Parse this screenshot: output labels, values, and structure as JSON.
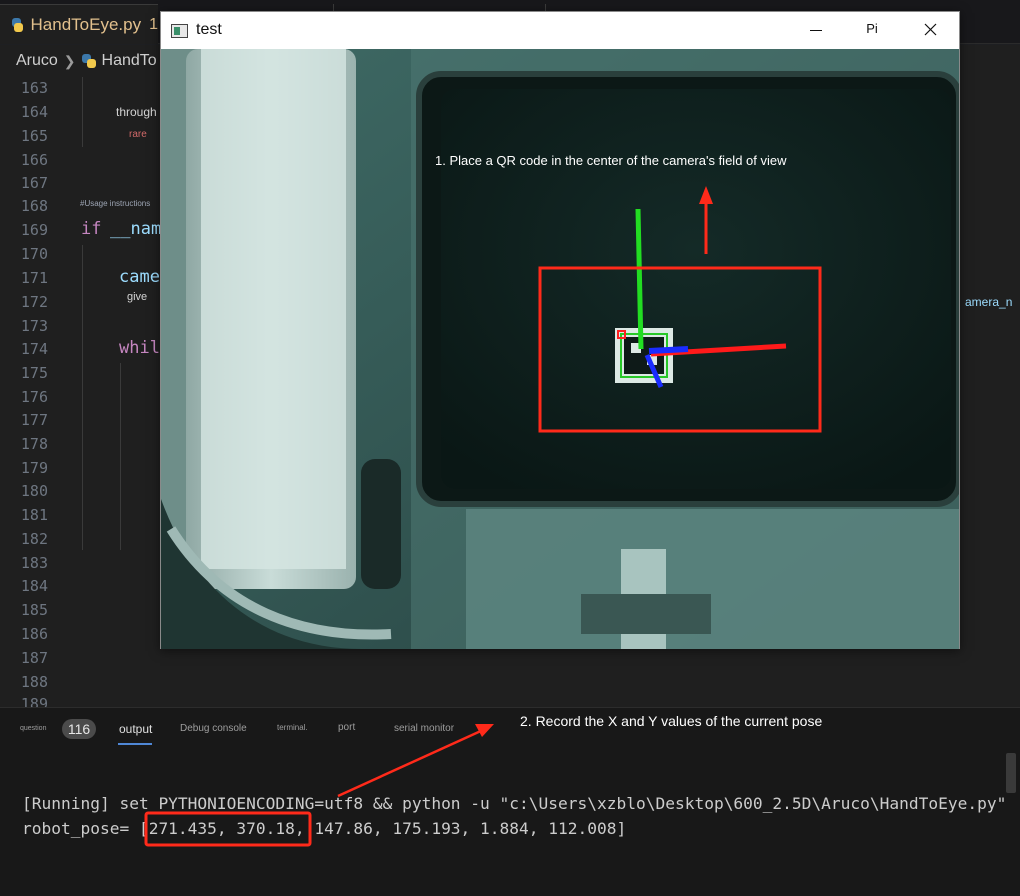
{
  "editor": {
    "active_tab": {
      "label": "HandToEye.py",
      "badge": "1"
    },
    "breadcrumb": {
      "folder": "Aruco",
      "file": "HandTo"
    },
    "line_numbers": [
      "163",
      "164",
      "165",
      "166",
      "167",
      "168",
      "169",
      "170",
      "171",
      "172",
      "173",
      "174",
      "175",
      "176",
      "177",
      "178",
      "179",
      "180",
      "181",
      "182",
      "183",
      "184",
      "185",
      "186",
      "187",
      "188",
      "189"
    ],
    "code": {
      "l164_hint": "through",
      "l165_hint": "rare",
      "l168_comment": "#Usage instructions",
      "l169_kw": "if",
      "l169_id": "__nam",
      "l171_id": "came",
      "l172_hint": "give",
      "l172_right": "amera_n",
      "l174_kw": "whil"
    }
  },
  "window": {
    "title": "test",
    "buttons": {
      "pin": "Pi",
      "close": "✕"
    },
    "camera_annotation_1": "1. Place a QR code in the center of the camera's field of view"
  },
  "panel": {
    "tabs": {
      "question": "question",
      "count": "116",
      "output": "output",
      "debug": "Debug console",
      "terminal": "terminal.",
      "port": "port",
      "serial": "serial monitor"
    },
    "annotation_2": "2. Record the X and Y values of the current pose",
    "lines": {
      "running": "[Running] set PYTHONIOENCODING=utf8 && python -u \"c:\\Users\\xzblo\\Desktop\\600_2.5D\\Aruco\\HandToEye.py\"",
      "pose": "robot_pose= [271.435, 370.18, 147.86, 175.193, 1.884, 112.008]"
    }
  },
  "colors": {
    "annotation_red": "#ff2a1a",
    "axis_green": "#2ee02e",
    "axis_blue": "#1428ff",
    "axis_red": "#ff1a1a",
    "camera_tint": "#3c6e68"
  }
}
